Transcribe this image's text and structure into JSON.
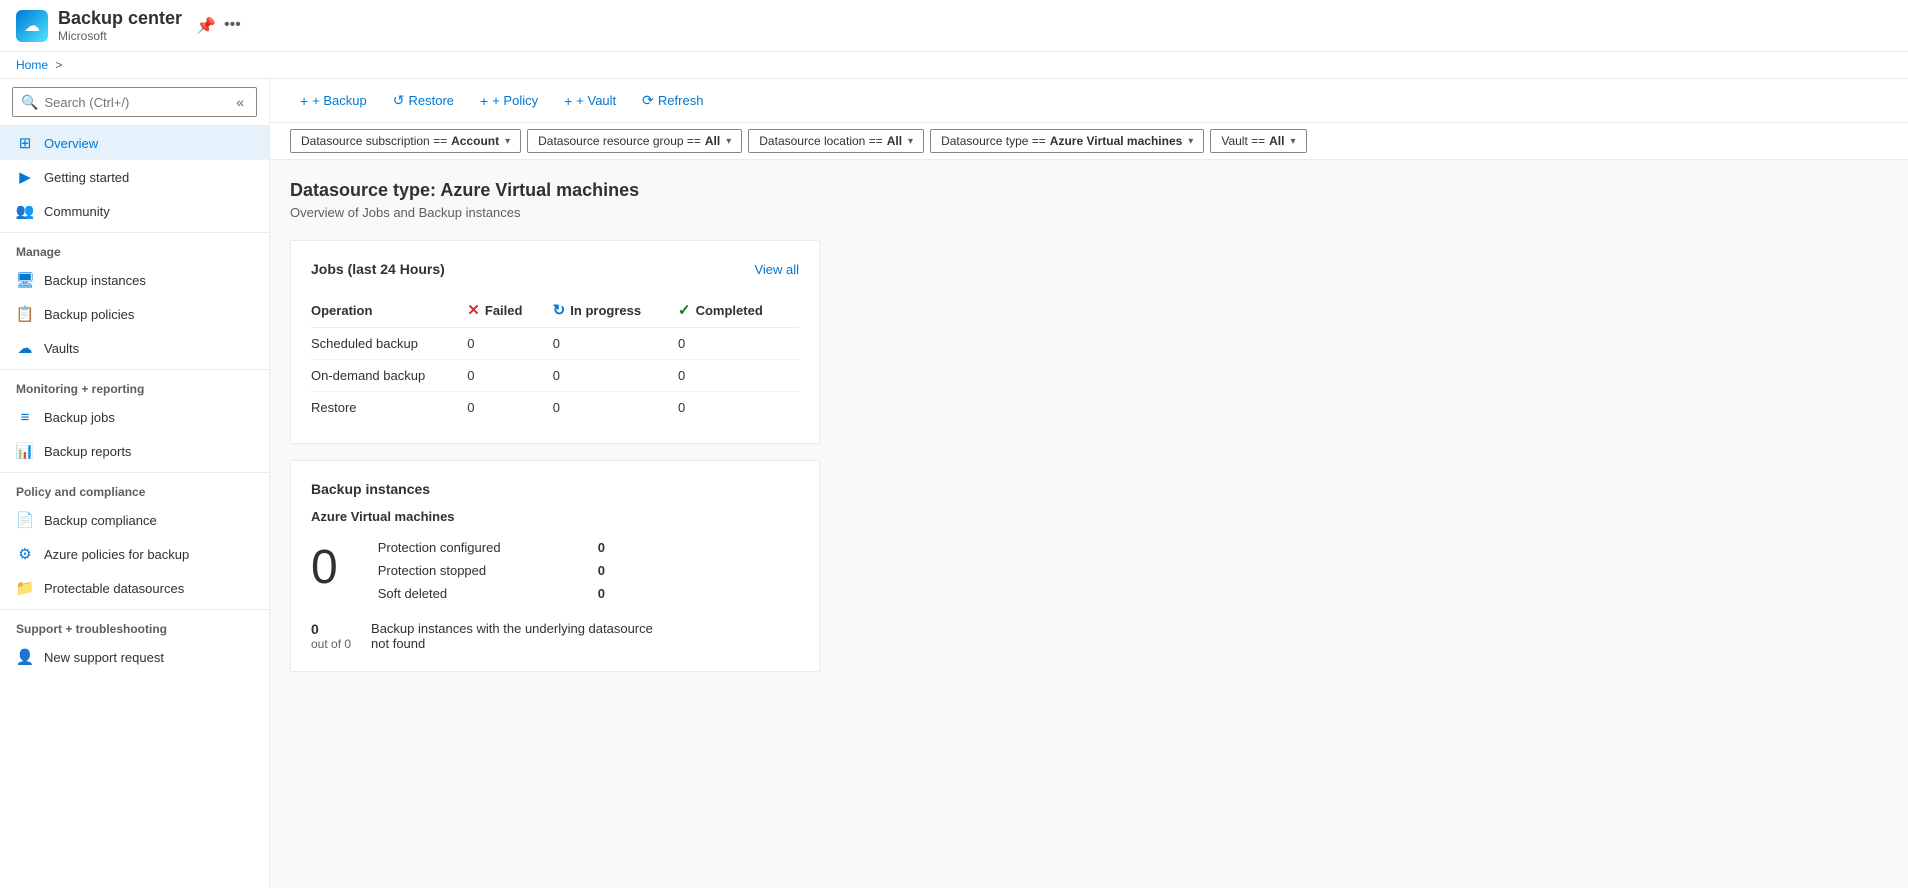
{
  "app": {
    "title": "Backup center",
    "subtitle": "Microsoft",
    "icon": "☁"
  },
  "breadcrumb": {
    "home": "Home",
    "separator": ">"
  },
  "search": {
    "placeholder": "Search (Ctrl+/)"
  },
  "toolbar": {
    "backup_label": "+ Backup",
    "restore_label": "Restore",
    "policy_label": "+ Policy",
    "vault_label": "+ Vault",
    "refresh_label": "Refresh"
  },
  "filters": [
    {
      "label": "Datasource subscription == ",
      "bold": "Account"
    },
    {
      "label": "Datasource resource group == ",
      "bold": "All"
    },
    {
      "label": "Datasource location == ",
      "bold": "All"
    },
    {
      "label": "Datasource type == ",
      "bold": "Azure Virtual machines"
    },
    {
      "label": "Vault == ",
      "bold": "All"
    }
  ],
  "sidebar": {
    "search_placeholder": "Search (Ctrl+/)",
    "nav_items": [
      {
        "id": "overview",
        "label": "Overview",
        "icon": "⊞",
        "active": true,
        "section": null
      },
      {
        "id": "getting-started",
        "label": "Getting started",
        "icon": "▶",
        "active": false,
        "section": null
      },
      {
        "id": "community",
        "label": "Community",
        "icon": "👥",
        "active": false,
        "section": null
      }
    ],
    "sections": [
      {
        "label": "Manage",
        "items": [
          {
            "id": "backup-instances",
            "label": "Backup instances",
            "icon": "🖥"
          },
          {
            "id": "backup-policies",
            "label": "Backup policies",
            "icon": "📋"
          },
          {
            "id": "vaults",
            "label": "Vaults",
            "icon": "☁"
          }
        ]
      },
      {
        "label": "Monitoring + reporting",
        "items": [
          {
            "id": "backup-jobs",
            "label": "Backup jobs",
            "icon": "≡"
          },
          {
            "id": "backup-reports",
            "label": "Backup reports",
            "icon": "📊"
          }
        ]
      },
      {
        "label": "Policy and compliance",
        "items": [
          {
            "id": "backup-compliance",
            "label": "Backup compliance",
            "icon": "📄"
          },
          {
            "id": "azure-policies",
            "label": "Azure policies for backup",
            "icon": "⚙"
          },
          {
            "id": "protectable-datasources",
            "label": "Protectable datasources",
            "icon": "📁"
          }
        ]
      },
      {
        "label": "Support + troubleshooting",
        "items": [
          {
            "id": "new-support-request",
            "label": "New support request",
            "icon": "👤"
          }
        ]
      }
    ]
  },
  "page": {
    "title": "Datasource type: Azure Virtual machines",
    "subtitle": "Overview of Jobs and Backup instances"
  },
  "jobs_card": {
    "title": "Jobs (last 24 Hours)",
    "view_all": "View all",
    "columns": {
      "operation": "Operation",
      "failed": "Failed",
      "in_progress": "In progress",
      "completed": "Completed"
    },
    "rows": [
      {
        "operation": "Scheduled backup",
        "failed": "0",
        "in_progress": "0",
        "completed": "0"
      },
      {
        "operation": "On-demand backup",
        "failed": "0",
        "in_progress": "0",
        "completed": "0"
      },
      {
        "operation": "Restore",
        "failed": "0",
        "in_progress": "0",
        "completed": "0"
      }
    ]
  },
  "backup_instances_card": {
    "title": "Backup instances",
    "vm_section": "Azure Virtual machines",
    "big_number": "0",
    "stats": [
      {
        "label": "Protection configured",
        "value": "0"
      },
      {
        "label": "Protection stopped",
        "value": "0"
      },
      {
        "label": "Soft deleted",
        "value": "0"
      }
    ],
    "bottom_number": "0",
    "bottom_sublabel": "out of 0",
    "bottom_desc": "Backup instances with the underlying datasource not found"
  }
}
